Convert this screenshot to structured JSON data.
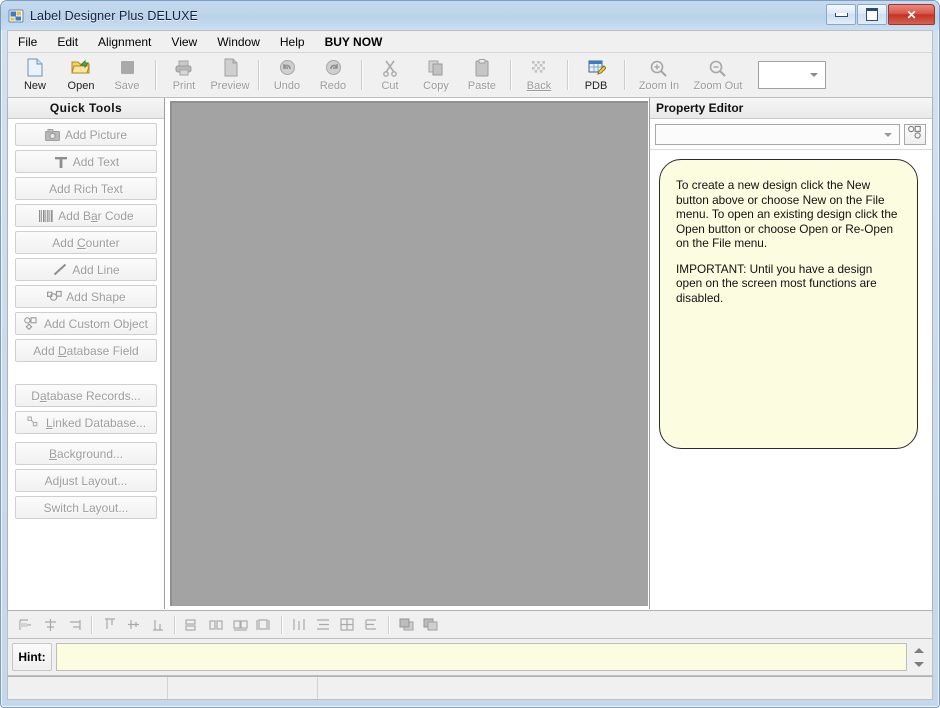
{
  "window": {
    "title": "Label Designer Plus DELUXE",
    "app_icon": "label-designer-icon",
    "controls": {
      "minimize": "Minimize",
      "maximize": "Maximize",
      "close": "✕"
    }
  },
  "menubar": {
    "items": [
      {
        "label": "File"
      },
      {
        "label": "Edit"
      },
      {
        "label": "Alignment"
      },
      {
        "label": "View"
      },
      {
        "label": "Window"
      },
      {
        "label": "Help"
      },
      {
        "label": "BUY NOW"
      }
    ]
  },
  "toolbar": {
    "buttons": [
      {
        "label": "New",
        "icon": "new-page-icon",
        "enabled": true
      },
      {
        "label": "Open",
        "icon": "open-folder-icon",
        "enabled": true
      },
      {
        "label": "Save",
        "icon": "save-disk-icon",
        "enabled": false
      },
      {
        "label": "Print",
        "icon": "printer-icon",
        "enabled": false
      },
      {
        "label": "Preview",
        "icon": "preview-page-icon",
        "enabled": false
      },
      {
        "label": "Undo",
        "icon": "undo-arrow-icon",
        "enabled": false
      },
      {
        "label": "Redo",
        "icon": "redo-arrow-icon",
        "enabled": false
      },
      {
        "label": "Cut",
        "icon": "scissors-icon",
        "enabled": false
      },
      {
        "label": "Copy",
        "icon": "copy-pages-icon",
        "enabled": false
      },
      {
        "label": "Paste",
        "icon": "clipboard-icon",
        "enabled": false
      },
      {
        "label": "Back",
        "icon": "background-grid-icon",
        "enabled": false
      },
      {
        "label": "PDB",
        "icon": "database-table-icon",
        "enabled": true
      },
      {
        "label": "Zoom In",
        "icon": "magnifier-plus-icon",
        "enabled": false
      },
      {
        "label": "Zoom Out",
        "icon": "magnifier-minus-icon",
        "enabled": false
      }
    ],
    "zoom_combo": {
      "value": "",
      "icon": "chevron-down-icon"
    }
  },
  "sidebar": {
    "header": "Quick Tools",
    "tools": [
      {
        "label": "Add Picture",
        "icon": "camera-icon",
        "enabled": false
      },
      {
        "label": "Add Text",
        "icon": "text-t-icon",
        "enabled": false
      },
      {
        "label": "Add Rich Text",
        "icon": "",
        "enabled": false
      },
      {
        "label": "Add Bar Code",
        "icon": "barcode-icon",
        "enabled": false
      },
      {
        "label": "Add Counter",
        "icon": "",
        "enabled": false
      },
      {
        "label": "Add Line",
        "icon": "diagonal-line-icon",
        "enabled": false
      },
      {
        "label": "Add Shape",
        "icon": "shapes-icon",
        "enabled": false
      },
      {
        "label": "Add Custom Object",
        "icon": "custom-object-icon",
        "enabled": false
      },
      {
        "label": "Add Database Field",
        "icon": "",
        "enabled": false
      }
    ],
    "actions": [
      {
        "label": "Database Records...",
        "icon": "",
        "enabled": false
      },
      {
        "label": "Linked Database...",
        "icon": "linked-database-icon",
        "enabled": false
      },
      {
        "label": "Background...",
        "icon": "",
        "enabled": false
      },
      {
        "label": "Adjust Layout...",
        "icon": "",
        "enabled": false
      },
      {
        "label": "Switch Layout...",
        "icon": "",
        "enabled": false
      }
    ]
  },
  "canvas": {
    "name": "mdi-client-area",
    "background_color": "#a3a3a3",
    "content": ""
  },
  "property_editor": {
    "header": "Property Editor",
    "object_combo": {
      "value": "",
      "icon": "chevron-down-icon"
    },
    "object_button_icon": "select-objects-icon",
    "note": {
      "paragraphs": [
        "To create a new design click the New button above or choose New on the File menu. To open an existing design click the Open button or choose Open or Re-Open on the File menu.",
        "IMPORTANT: Until you have a design open on the screen most functions are disabled."
      ],
      "background_color": "#fcfce0"
    }
  },
  "align_toolbar": {
    "groups": [
      [
        {
          "icon": "align-left-icon"
        },
        {
          "icon": "align-center-horizontal-icon"
        },
        {
          "icon": "align-right-icon"
        }
      ],
      [
        {
          "icon": "align-top-icon"
        },
        {
          "icon": "align-middle-vertical-icon"
        },
        {
          "icon": "align-bottom-icon"
        }
      ],
      [
        {
          "icon": "same-width-icon"
        },
        {
          "icon": "same-height-icon"
        },
        {
          "icon": "same-size-icon"
        },
        {
          "icon": "size-to-grid-icon"
        }
      ],
      [
        {
          "icon": "space-horizontal-icon"
        },
        {
          "icon": "space-vertical-icon"
        },
        {
          "icon": "center-in-label-icon"
        },
        {
          "icon": "align-to-grid-icon"
        }
      ],
      [
        {
          "icon": "bring-to-front-icon"
        },
        {
          "icon": "send-to-back-icon"
        }
      ]
    ]
  },
  "hint_bar": {
    "label": "Hint:",
    "value": "",
    "placeholder": "",
    "background_color": "#fcfce0",
    "spinner_icon": "spinner-updown-icon"
  },
  "status_bar": {
    "cells": [
      "",
      "",
      ""
    ]
  },
  "colors": {
    "titlebar": "#bdd4ea",
    "close_button": "#c23425",
    "panel": "#f0f0f0",
    "canvas": "#a3a3a3",
    "note": "#fcfce0",
    "disabled_text": "#9d9d9d"
  }
}
